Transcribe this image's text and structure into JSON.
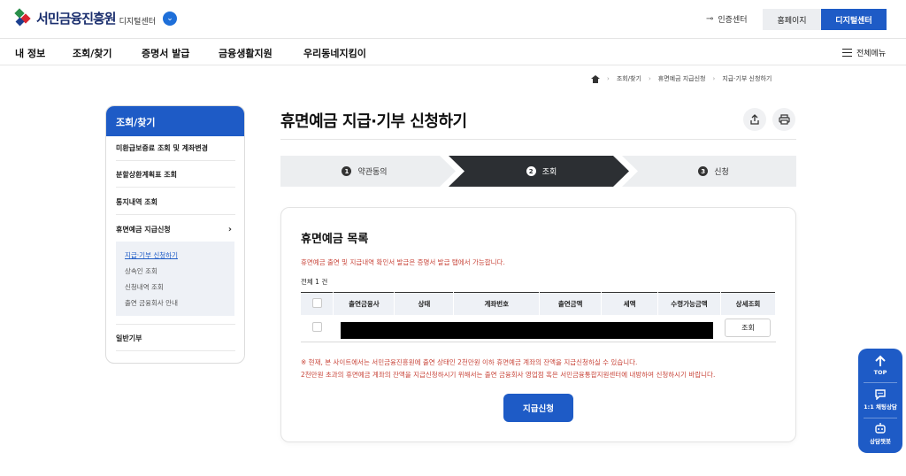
{
  "header": {
    "logo_text": "서민금융진흥원",
    "logo_sub": "디지털센터",
    "cert_label": "인증센터",
    "home_btn": "홈페이지",
    "digital_btn": "디지털센터"
  },
  "gnb": {
    "items": [
      "내 정보",
      "조회/찾기",
      "증명서 발급",
      "금융생활지원",
      "우리동네지킴이"
    ],
    "all_menu": "전체메뉴"
  },
  "breadcrumb": [
    "조회/찾기",
    "휴면예금 지급신청",
    "지급·기부 신청하기"
  ],
  "sidebar": {
    "title": "조회/찾기",
    "items": [
      "미환급보증료 조회 및 계좌변경",
      "분할상환계획표 조회",
      "통지내역 조회",
      "휴면예금 지급신청",
      "일반기부"
    ],
    "sub_items": [
      "지급·기부 신청하기",
      "상속인 조회",
      "신청내역 조회",
      "출연 금융회사 안내"
    ]
  },
  "main": {
    "title": "휴면예금 지급·기부 신청하기",
    "steps": [
      {
        "num": "1",
        "label": "약관동의"
      },
      {
        "num": "2",
        "label": "조회"
      },
      {
        "num": "3",
        "label": "신청"
      }
    ],
    "active_step": 2,
    "list_title": "휴면예금 목록",
    "notice": "휴면예금 출연 및 지급내역 확인서 발급은 증명서 발급 탭에서 가능합니다.",
    "total": "전체 1 건",
    "table": {
      "headers": [
        "출연금융사",
        "상태",
        "계좌번호",
        "출연금액",
        "세액",
        "수령가능금액",
        "상세조회"
      ],
      "row_button": "조회"
    },
    "warning_1": "※ 현재, 본 사이트에서는 서민금융진흥원에 출연 상태인 2천만원 이하 휴면예금 계좌의 잔액을 지급신청하실 수 있습니다.",
    "warning_2": "2천만원 초과의 휴면예금 계좌의 잔액을 지급신청하시기 위해서는 출연 금융회사 영업점 혹은 서민금융통합지원센터에 내방하여 신청하시기 바랍니다.",
    "apply_btn": "지급신청"
  },
  "floating": {
    "top": "TOP",
    "chat": "1:1 채팅상담",
    "bot": "상담챗봇"
  },
  "colors": {
    "primary": "#1e5bc6",
    "active_step": "#2c2f33",
    "step_inactive": "#eceef0",
    "warning": "#c8453a"
  }
}
